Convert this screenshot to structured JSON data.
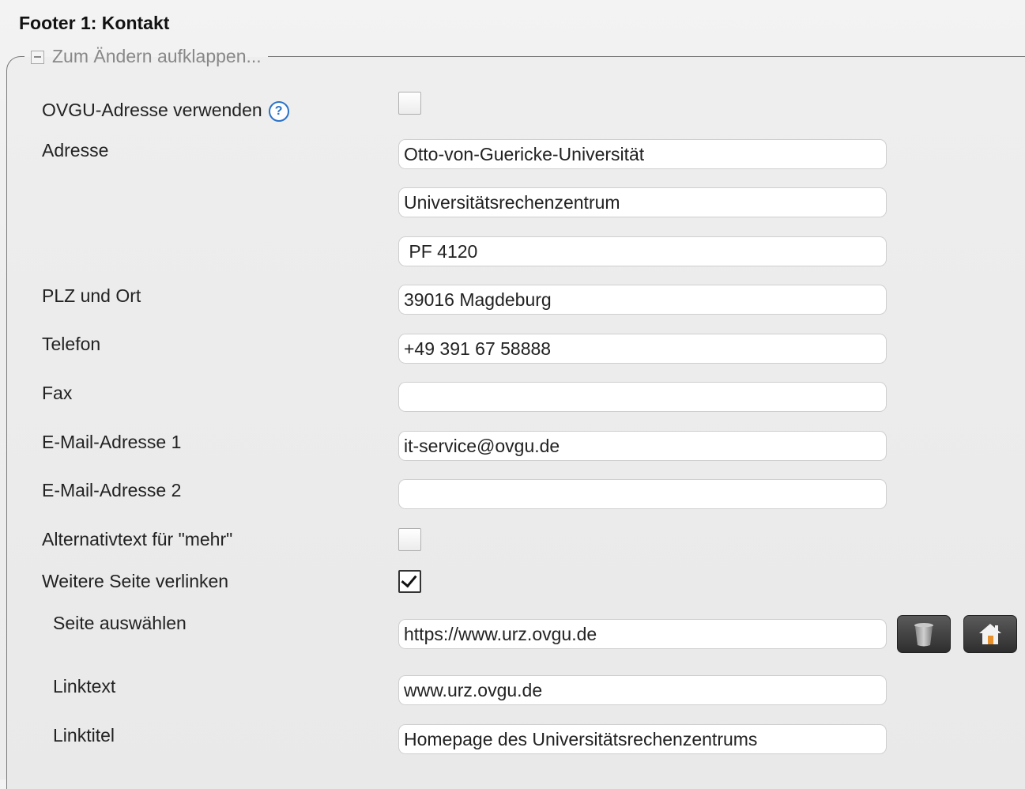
{
  "section": {
    "title": "Footer 1: Kontakt",
    "legend": "Zum Ändern aufklappen..."
  },
  "form": {
    "ovgu_address": {
      "label": "OVGU-Adresse verwenden",
      "help_icon": "question-circle-icon",
      "checked": false
    },
    "address": {
      "label": "Adresse",
      "line1": "Otto-von-Guericke-Universität",
      "line2": "Universitätsrechenzentrum",
      "line3": " PF 4120"
    },
    "plz_ort": {
      "label": "PLZ und Ort",
      "value": "39016 Magdeburg"
    },
    "telefon": {
      "label": "Telefon",
      "value": "+49 391 67 58888"
    },
    "fax": {
      "label": "Fax",
      "value": ""
    },
    "email1": {
      "label": "E-Mail-Adresse 1",
      "value": "it-service@ovgu.de"
    },
    "email2": {
      "label": "E-Mail-Adresse 2",
      "value": ""
    },
    "alt_text": {
      "label": "Alternativtext für \"mehr\"",
      "checked": false
    },
    "link_page": {
      "label": "Weitere Seite verlinken",
      "checked": true
    },
    "select_page": {
      "label": "Seite auswählen",
      "value": "https://www.urz.ovgu.de",
      "delete_icon": "trash-icon",
      "home_icon": "home-icon"
    },
    "linktext": {
      "label": "Linktext",
      "value": "www.urz.ovgu.de"
    },
    "linktitel": {
      "label": "Linktitel",
      "value": "Homepage des Universitätsrechenzentrums"
    }
  },
  "colors": {
    "help_blue": "#2b73c7",
    "home_orange": "#e8902c",
    "button_dark": "#3a3a3a"
  }
}
